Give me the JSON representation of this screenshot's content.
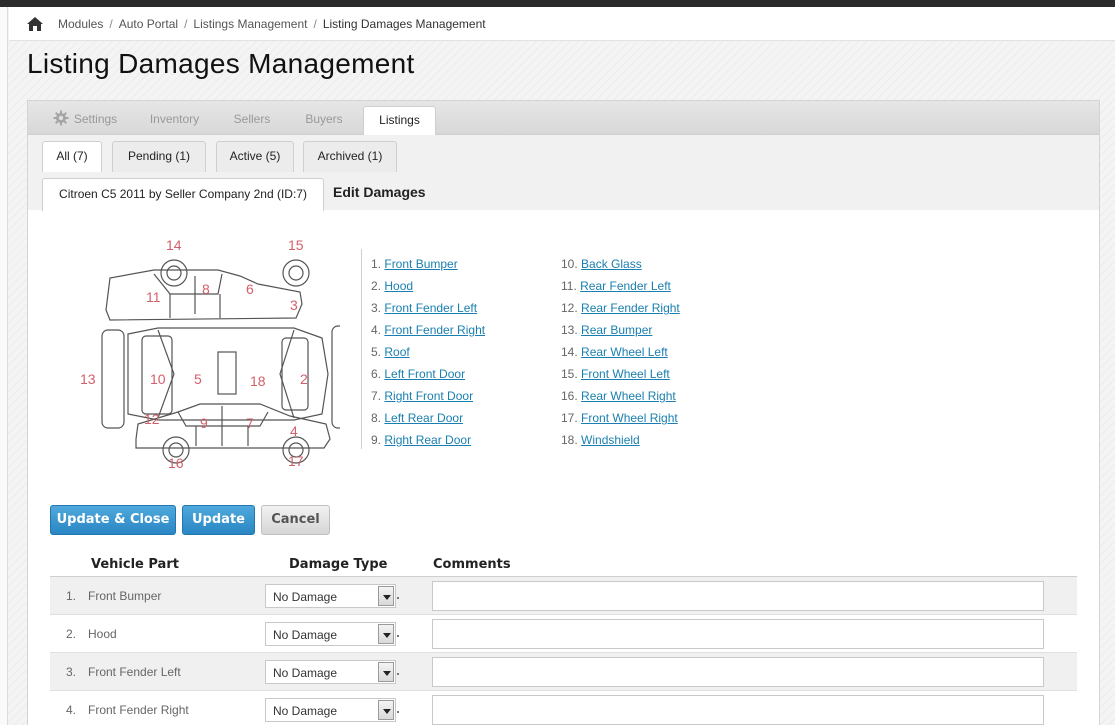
{
  "breadcrumb": {
    "items": [
      "Modules",
      "Auto Portal",
      "Listings Management"
    ],
    "current": "Listing Damages Management",
    "separator": "/"
  },
  "page": {
    "title": "Listing Damages Management"
  },
  "main_tabs": [
    {
      "label": "Settings",
      "icon": "gear-icon"
    },
    {
      "label": "Inventory"
    },
    {
      "label": "Sellers"
    },
    {
      "label": "Buyers"
    },
    {
      "label": "Listings",
      "active": true
    }
  ],
  "sub_tabs": [
    {
      "label": "All (7)",
      "active": true
    },
    {
      "label": "Pending (1)"
    },
    {
      "label": "Active (5)"
    },
    {
      "label": "Archived (1)"
    }
  ],
  "edit": {
    "listing_tab": "Citroen C5 2011 by Seller Company 2nd (ID:7)",
    "heading": "Edit Damages"
  },
  "diagram_labels": [
    "1",
    "2",
    "3",
    "4",
    "5",
    "6",
    "7",
    "8",
    "9",
    "10",
    "11",
    "12",
    "13",
    "14",
    "15",
    "16",
    "17",
    "18"
  ],
  "parts": [
    {
      "num": "1.",
      "name": "Front Bumper"
    },
    {
      "num": "2.",
      "name": "Hood"
    },
    {
      "num": "3.",
      "name": "Front Fender Left"
    },
    {
      "num": "4.",
      "name": "Front Fender Right"
    },
    {
      "num": "5.",
      "name": "Roof"
    },
    {
      "num": "6.",
      "name": "Left Front Door"
    },
    {
      "num": "7.",
      "name": "Right Front Door"
    },
    {
      "num": "8.",
      "name": "Left Rear Door"
    },
    {
      "num": "9.",
      "name": "Right Rear Door"
    },
    {
      "num": "10.",
      "name": "Back Glass"
    },
    {
      "num": "11.",
      "name": "Rear Fender Left"
    },
    {
      "num": "12.",
      "name": "Rear Fender Right"
    },
    {
      "num": "13.",
      "name": "Rear Bumper"
    },
    {
      "num": "14.",
      "name": "Rear Wheel Left"
    },
    {
      "num": "15.",
      "name": "Front Wheel Left"
    },
    {
      "num": "16.",
      "name": "Rear Wheel Right"
    },
    {
      "num": "17.",
      "name": "Front Wheel Right"
    },
    {
      "num": "18.",
      "name": "Windshield"
    }
  ],
  "buttons": {
    "update_close": "Update & Close",
    "update": "Update",
    "cancel": "Cancel"
  },
  "grid": {
    "headers": {
      "part": "Vehicle Part",
      "damage": "Damage Type",
      "comments": "Comments"
    },
    "rows": [
      {
        "num": "1.",
        "part": "Front Bumper",
        "damage": "No Damage",
        "comment": ""
      },
      {
        "num": "2.",
        "part": "Hood",
        "damage": "No Damage",
        "comment": ""
      },
      {
        "num": "3.",
        "part": "Front Fender Left",
        "damage": "No Damage",
        "comment": ""
      },
      {
        "num": "4.",
        "part": "Front Fender Right",
        "damage": "No Damage",
        "comment": ""
      }
    ]
  },
  "colors": {
    "link": "#1a7fb0",
    "primary_button": "#2a86c3",
    "diagram_number": "#d2606a",
    "diagram_line": "#555555"
  }
}
